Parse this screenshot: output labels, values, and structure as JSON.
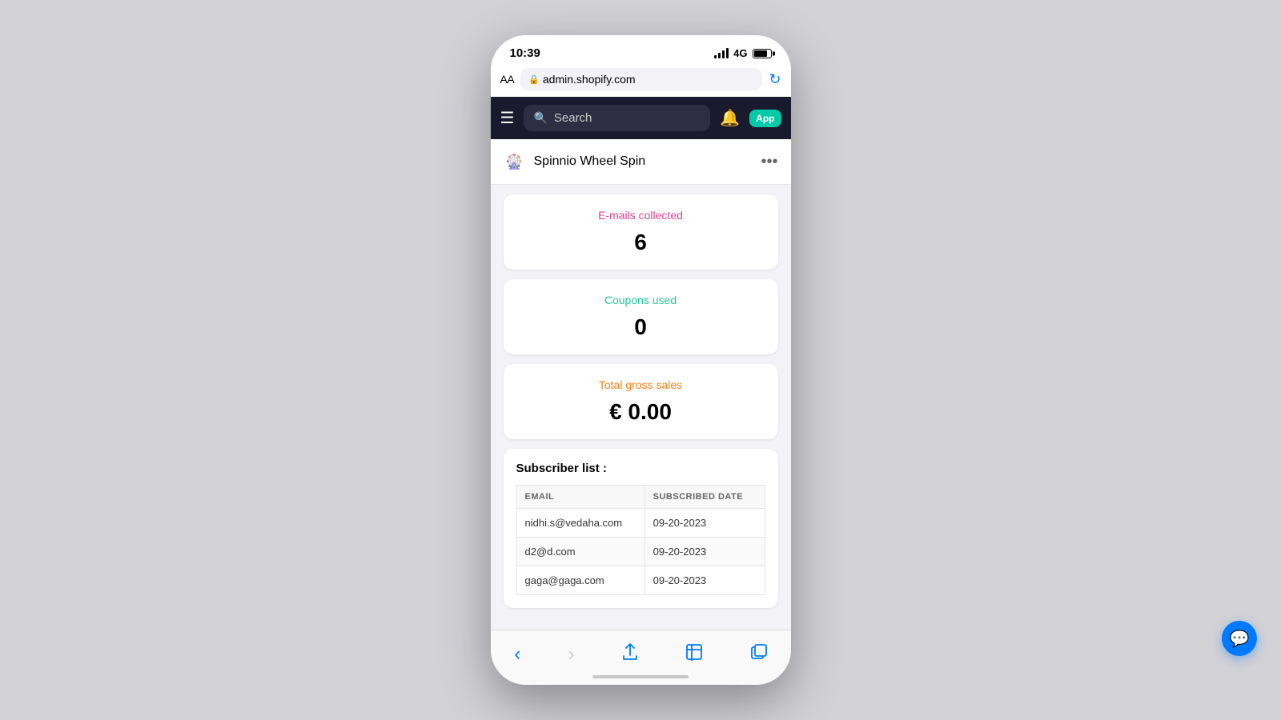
{
  "status_bar": {
    "time": "10:39",
    "network": "4G"
  },
  "browser": {
    "aa_label": "AA",
    "url": "admin.shopify.com",
    "reload_icon": "↻"
  },
  "shopify_nav": {
    "search_placeholder": "Search",
    "app_badge": "App"
  },
  "app_header": {
    "title": "Spinnio Wheel Spin",
    "icon_emoji": "🎡"
  },
  "stats": {
    "emails": {
      "label": "E-mails collected",
      "value": "6",
      "label_class": "label-pink"
    },
    "coupons": {
      "label": "Coupons used",
      "value": "0",
      "label_class": "label-teal"
    },
    "sales": {
      "label": "Total gross sales",
      "value": "€ 0.00",
      "label_class": "label-orange"
    }
  },
  "subscriber_list": {
    "title": "Subscriber list :",
    "columns": [
      "EMAIL",
      "SUBSCRIBED DATE"
    ],
    "rows": [
      {
        "email": "nidhi.s@vedaha.com",
        "date": "09-20-2023"
      },
      {
        "email": "d2@d.com",
        "date": "09-20-2023"
      },
      {
        "email": "gaga@gaga.com",
        "date": "09-20-2023"
      }
    ]
  },
  "bottom_nav": {
    "back_icon": "‹",
    "forward_icon": "›",
    "share_icon": "⎋",
    "bookmarks_icon": "📖",
    "tabs_icon": "⧉"
  }
}
